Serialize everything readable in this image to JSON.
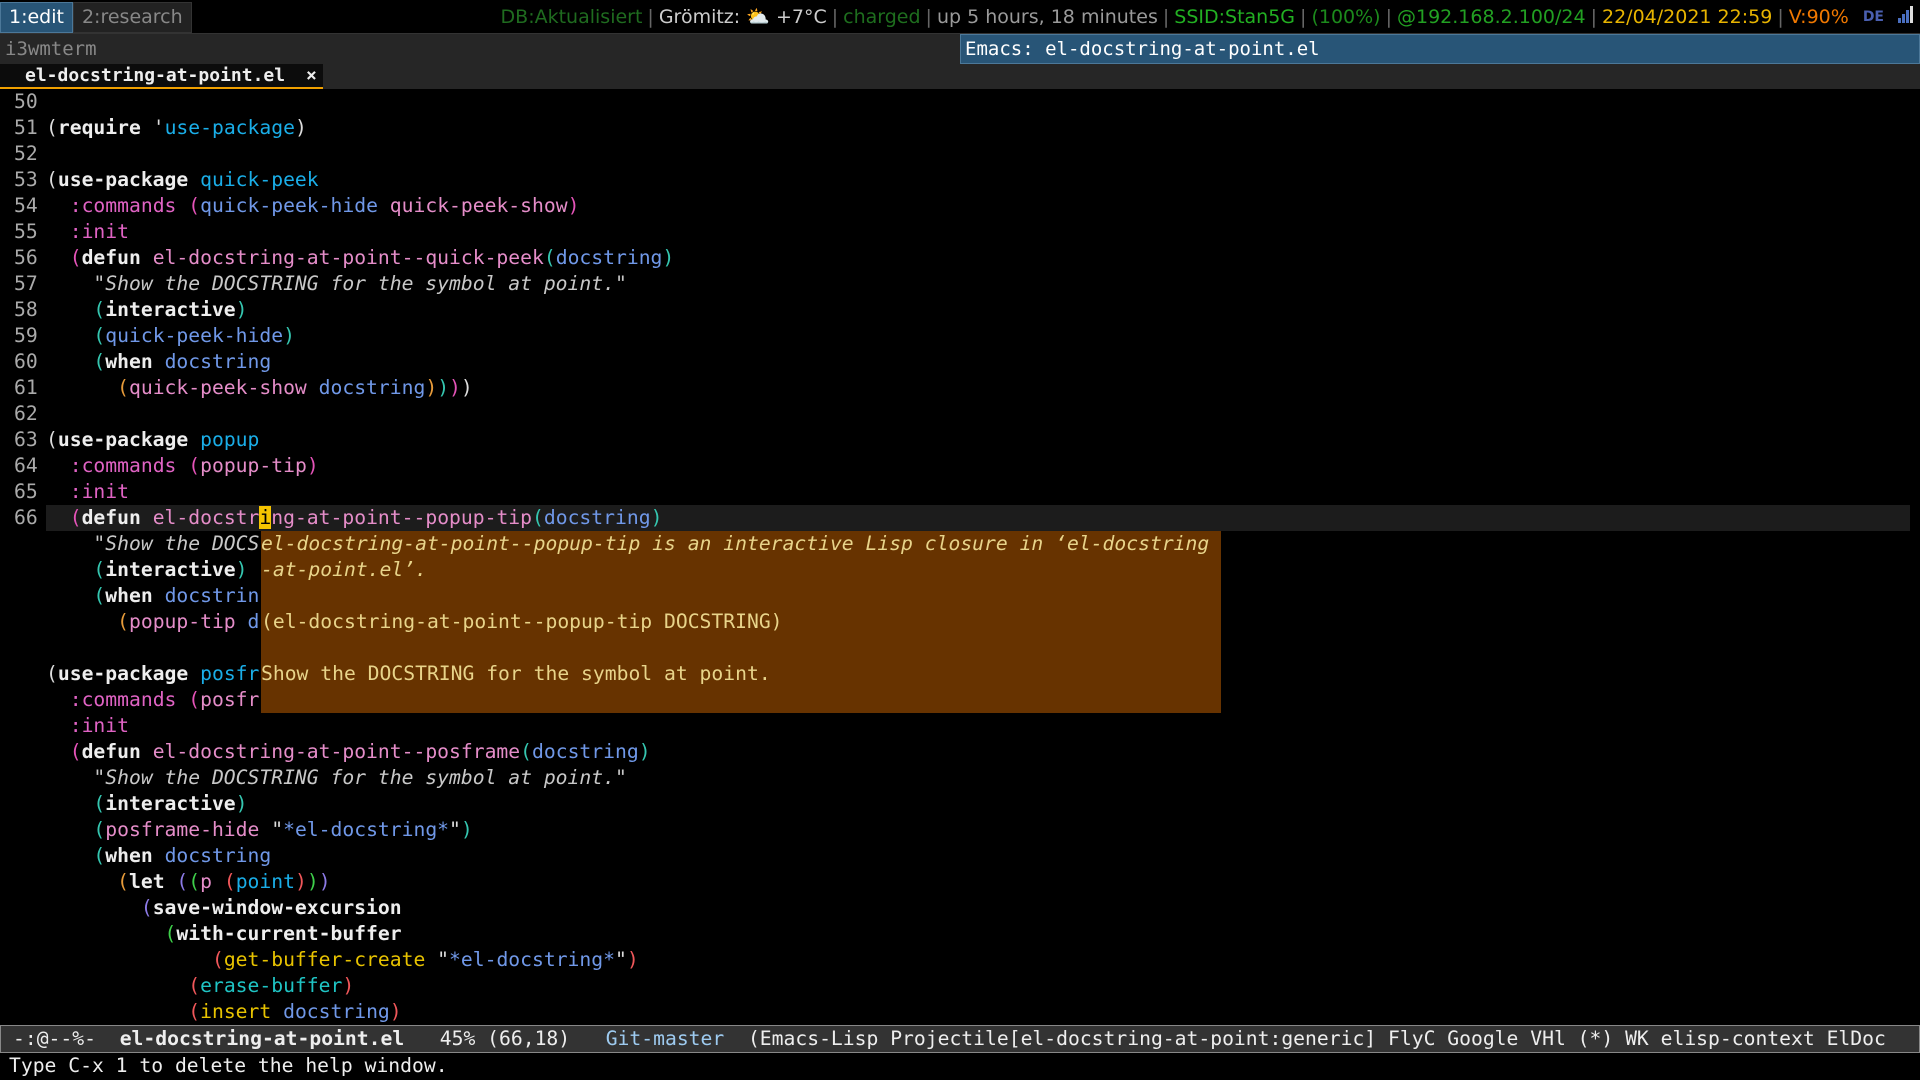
{
  "workspaces": [
    {
      "label": "1:edit",
      "active": true
    },
    {
      "label": "2:research",
      "active": false
    }
  ],
  "status": [
    {
      "text": "DB:Aktualisiert",
      "color": "#1f6b1f"
    },
    {
      "text": "Grömitz:",
      "color": "#cccccc",
      "icon": "weather-partly-cloudy-icon",
      "extra": "+7°C"
    },
    {
      "text": "charged",
      "color": "#1e6e1e"
    },
    {
      "text": "up 5 hours, 18 minutes",
      "color": "#9a9a9a"
    },
    {
      "text": "SSID:Stan5G",
      "color": "#22b022"
    },
    {
      "text": "(100%)",
      "color": "#1c8a1c"
    },
    {
      "text": "@192.168.2.100/24",
      "color": "#22a022"
    },
    {
      "text": "22/04/2021 22:59",
      "color": "#e8b400"
    },
    {
      "text": "V:90%",
      "color": "#f07800"
    }
  ],
  "keyboard_layout": "DE",
  "titlebar": {
    "left": "i3wmterm",
    "right": "Emacs: el-docstring-at-point.el"
  },
  "tab": {
    "label": "el-docstring-at-point.el",
    "close": "×"
  },
  "editor": {
    "lines": [
      {
        "n": "50",
        "s": []
      },
      {
        "n": "51",
        "s": [
          [
            "(",
            "pw"
          ],
          [
            "require",
            "w"
          ],
          [
            " '",
            "pw"
          ],
          [
            "use-package",
            "cy"
          ],
          [
            ")",
            "pw"
          ]
        ]
      },
      {
        "n": "52",
        "s": []
      },
      {
        "n": "53",
        "s": [
          [
            "(",
            "pw"
          ],
          [
            "use-package",
            "w"
          ],
          [
            " ",
            ""
          ],
          [
            "quick-peek",
            "cy"
          ]
        ]
      },
      {
        "n": "54",
        "s": [
          [
            "  ",
            ""
          ],
          [
            ":commands",
            "key"
          ],
          [
            " ",
            ""
          ],
          [
            "(",
            "pm"
          ],
          [
            "quick-peek-hide",
            "bl"
          ],
          [
            " ",
            ""
          ],
          [
            "quick-peek-show",
            "fn"
          ],
          [
            ")",
            "pm"
          ]
        ]
      },
      {
        "n": "55",
        "s": [
          [
            "  ",
            ""
          ],
          [
            ":init",
            "key"
          ]
        ]
      },
      {
        "n": "56",
        "s": [
          [
            "  ",
            ""
          ],
          [
            "(",
            "pm"
          ],
          [
            "defun",
            "w"
          ],
          [
            " ",
            ""
          ],
          [
            "el-docstring-at-point--quick-peek",
            "fn"
          ],
          [
            "(",
            "pt"
          ],
          [
            "docstring",
            "bl"
          ],
          [
            ")",
            "pt"
          ]
        ]
      },
      {
        "n": "57",
        "s": [
          [
            "    ",
            ""
          ],
          [
            "\"Show the DOCSTRING for the symbol at point.\"",
            "st"
          ]
        ]
      },
      {
        "n": "58",
        "s": [
          [
            "    ",
            ""
          ],
          [
            "(",
            "pt"
          ],
          [
            "interactive",
            "w"
          ],
          [
            ")",
            "pt"
          ]
        ]
      },
      {
        "n": "59",
        "s": [
          [
            "    ",
            ""
          ],
          [
            "(",
            "pt"
          ],
          [
            "quick-peek-hide",
            "bl"
          ],
          [
            ")",
            "pt"
          ]
        ]
      },
      {
        "n": "60",
        "s": [
          [
            "    ",
            ""
          ],
          [
            "(",
            "pt"
          ],
          [
            "when",
            "w"
          ],
          [
            " ",
            ""
          ],
          [
            "docstring",
            "bl"
          ]
        ]
      },
      {
        "n": "61",
        "s": [
          [
            "      ",
            ""
          ],
          [
            "(",
            "po"
          ],
          [
            "quick-peek-show",
            "fn"
          ],
          [
            " ",
            ""
          ],
          [
            "docstring",
            "bl"
          ],
          [
            ")",
            "po"
          ],
          [
            ")",
            "pt"
          ],
          [
            ")",
            "pm"
          ],
          [
            ")",
            "pw"
          ]
        ]
      },
      {
        "n": "62",
        "s": []
      },
      {
        "n": "63",
        "s": [
          [
            "(",
            "pw"
          ],
          [
            "use-package",
            "w"
          ],
          [
            " ",
            ""
          ],
          [
            "popup",
            "cy"
          ]
        ]
      },
      {
        "n": "64",
        "s": [
          [
            "  ",
            ""
          ],
          [
            ":commands",
            "key"
          ],
          [
            " ",
            ""
          ],
          [
            "(",
            "pm"
          ],
          [
            "popup-tip",
            "fn"
          ],
          [
            ")",
            "pm"
          ]
        ]
      },
      {
        "n": "65",
        "s": [
          [
            "  ",
            ""
          ],
          [
            ":init",
            "key"
          ]
        ]
      },
      {
        "n": "66",
        "current": true,
        "s": [
          [
            "  ",
            ""
          ],
          [
            "(",
            "pm"
          ],
          [
            "defun",
            "w"
          ],
          [
            " ",
            ""
          ],
          [
            "el-docstr",
            "fn"
          ],
          [
            "i",
            "cur-ch"
          ],
          [
            "ng-at-point--popup-tip",
            "fn"
          ],
          [
            "(",
            "pt"
          ],
          [
            "docstring",
            "bl"
          ],
          [
            ")",
            "pt"
          ]
        ]
      },
      {
        "n": "",
        "s": [
          [
            "    ",
            ""
          ],
          [
            "\"Show the DOCS",
            "st"
          ]
        ]
      },
      {
        "n": "",
        "s": [
          [
            "    ",
            ""
          ],
          [
            "(",
            "pt"
          ],
          [
            "interactive",
            "w"
          ],
          [
            ")",
            "pt"
          ]
        ]
      },
      {
        "n": "",
        "s": [
          [
            "    ",
            ""
          ],
          [
            "(",
            "pt"
          ],
          [
            "when",
            "w"
          ],
          [
            " ",
            ""
          ],
          [
            "docstrin",
            "bl"
          ]
        ]
      },
      {
        "n": "",
        "s": [
          [
            "      ",
            ""
          ],
          [
            "(",
            "po"
          ],
          [
            "popup-tip",
            "fn"
          ],
          [
            " ",
            ""
          ],
          [
            "d",
            "bl"
          ]
        ]
      },
      {
        "n": "",
        "s": []
      },
      {
        "n": "",
        "s": [
          [
            "(",
            "pw"
          ],
          [
            "use-package",
            "w"
          ],
          [
            " ",
            ""
          ],
          [
            "posfr",
            "cy"
          ]
        ]
      },
      {
        "n": "",
        "s": [
          [
            "  ",
            ""
          ],
          [
            ":commands",
            "key"
          ],
          [
            " ",
            ""
          ],
          [
            "(",
            "pm"
          ],
          [
            "posfr",
            "fn"
          ]
        ]
      },
      {
        "n": "",
        "s": [
          [
            "  ",
            ""
          ],
          [
            ":init",
            "key"
          ]
        ]
      },
      {
        "n": "",
        "s": [
          [
            "  ",
            ""
          ],
          [
            "(",
            "pm"
          ],
          [
            "defun",
            "w"
          ],
          [
            " ",
            ""
          ],
          [
            "el-docstring-at-point--posframe",
            "fn"
          ],
          [
            "(",
            "pt"
          ],
          [
            "docstring",
            "bl"
          ],
          [
            ")",
            "pt"
          ]
        ]
      },
      {
        "n": "",
        "s": [
          [
            "    ",
            ""
          ],
          [
            "\"Show the DOCSTRING for the symbol at point.\"",
            "st"
          ]
        ]
      },
      {
        "n": "",
        "s": [
          [
            "    ",
            ""
          ],
          [
            "(",
            "pt"
          ],
          [
            "interactive",
            "w"
          ],
          [
            ")",
            "pt"
          ]
        ]
      },
      {
        "n": "",
        "s": [
          [
            "    ",
            ""
          ],
          [
            "(",
            "pt"
          ],
          [
            "posframe-hide",
            "fn"
          ],
          [
            " ",
            ""
          ],
          [
            "\"",
            "pw"
          ],
          [
            "*el-docstring*",
            "bl"
          ],
          [
            "\"",
            "pw"
          ],
          [
            ")",
            "pt"
          ]
        ]
      },
      {
        "n": "",
        "s": [
          [
            "    ",
            ""
          ],
          [
            "(",
            "pt"
          ],
          [
            "when",
            "w"
          ],
          [
            " ",
            ""
          ],
          [
            "docstring",
            "bl"
          ]
        ]
      },
      {
        "n": "",
        "s": [
          [
            "      ",
            ""
          ],
          [
            "(",
            "po"
          ],
          [
            "let",
            "w"
          ],
          [
            " ",
            ""
          ],
          [
            "(",
            "pp"
          ],
          [
            "(",
            "pg"
          ],
          [
            "p",
            "fn"
          ],
          [
            " ",
            ""
          ],
          [
            "(",
            "pr"
          ],
          [
            "point",
            "cy"
          ],
          [
            ")",
            "pr"
          ],
          [
            ")",
            "pg"
          ],
          [
            ")",
            "pp"
          ]
        ]
      },
      {
        "n": "",
        "s": [
          [
            "        ",
            ""
          ],
          [
            "(",
            "pp"
          ],
          [
            "save-window-excursion",
            "w"
          ]
        ]
      },
      {
        "n": "",
        "s": [
          [
            "          ",
            ""
          ],
          [
            "(",
            "pg"
          ],
          [
            "with-current-buffer",
            "w"
          ]
        ]
      },
      {
        "n": "",
        "s": [
          [
            "              ",
            ""
          ],
          [
            "(",
            "pr"
          ],
          [
            "get-buffer-create",
            "ye"
          ],
          [
            " ",
            ""
          ],
          [
            "\"",
            "pw"
          ],
          [
            "*el-docstring*",
            "bl"
          ],
          [
            "\"",
            "pw"
          ],
          [
            ")",
            "pr"
          ]
        ]
      },
      {
        "n": "",
        "s": [
          [
            "            ",
            ""
          ],
          [
            "(",
            "pr"
          ],
          [
            "erase-buffer",
            "tl"
          ],
          [
            ")",
            "pr"
          ]
        ]
      },
      {
        "n": "",
        "s": [
          [
            "            ",
            ""
          ],
          [
            "(",
            "pr"
          ],
          [
            "insert",
            "ye"
          ],
          [
            " ",
            ""
          ],
          [
            "docstring",
            "bl"
          ],
          [
            ")",
            "pr"
          ]
        ]
      }
    ]
  },
  "popup": {
    "lines": [
      "el-docstring-at-point--popup-tip is an interactive Lisp closure in ‘el-docstring",
      "-at-point.el’.",
      "",
      "(el-docstring-at-point--popup-tip DOCSTRING)",
      "",
      "Show the DOCSTRING for the symbol at point.",
      ""
    ]
  },
  "modeline": {
    "flags": "-:@--%-",
    "buffer": "el-docstring-at-point.el",
    "position": "45% (66,18)",
    "vc": "Git-master",
    "modes": "(Emacs-Lisp Projectile[el-docstring-at-point:generic] FlyC Google VHl (*) WK elisp-context ElDoc"
  },
  "minibuffer": "Type C-x 1 to delete the help window."
}
